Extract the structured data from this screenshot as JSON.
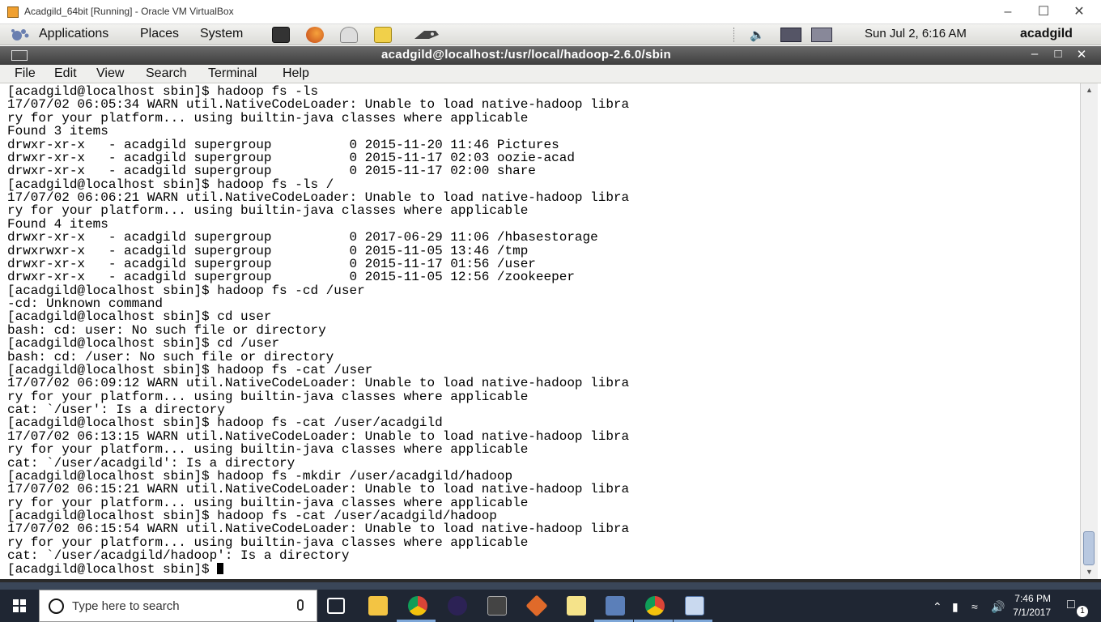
{
  "host_window": {
    "title": "Acadgild_64bit [Running] - Oracle VM VirtualBox"
  },
  "gnome_panel": {
    "menus": [
      "Applications",
      "Places",
      "System"
    ],
    "clock": "Sun Jul  2,  6:16 AM",
    "user": "acadgild"
  },
  "terminal": {
    "title": "acadgild@localhost:/usr/local/hadoop-2.6.0/sbin",
    "menus": [
      "File",
      "Edit",
      "View",
      "Search",
      "Terminal",
      "Help"
    ],
    "lines": [
      "[acadgild@localhost sbin]$ hadoop fs -ls",
      "17/07/02 06:05:34 WARN util.NativeCodeLoader: Unable to load native-hadoop libra",
      "ry for your platform... using builtin-java classes where applicable",
      "Found 3 items",
      "drwxr-xr-x   - acadgild supergroup          0 2015-11-20 11:46 Pictures",
      "drwxr-xr-x   - acadgild supergroup          0 2015-11-17 02:03 oozie-acad",
      "drwxr-xr-x   - acadgild supergroup          0 2015-11-17 02:00 share",
      "[acadgild@localhost sbin]$ hadoop fs -ls /",
      "17/07/02 06:06:21 WARN util.NativeCodeLoader: Unable to load native-hadoop libra",
      "ry for your platform... using builtin-java classes where applicable",
      "Found 4 items",
      "drwxr-xr-x   - acadgild supergroup          0 2017-06-29 11:06 /hbasestorage",
      "drwxrwxr-x   - acadgild supergroup          0 2015-11-05 13:46 /tmp",
      "drwxr-xr-x   - acadgild supergroup          0 2015-11-17 01:56 /user",
      "drwxr-xr-x   - acadgild supergroup          0 2015-11-05 12:56 /zookeeper",
      "[acadgild@localhost sbin]$ hadoop fs -cd /user",
      "-cd: Unknown command",
      "[acadgild@localhost sbin]$ cd user",
      "bash: cd: user: No such file or directory",
      "[acadgild@localhost sbin]$ cd /user",
      "bash: cd: /user: No such file or directory",
      "[acadgild@localhost sbin]$ hadoop fs -cat /user",
      "17/07/02 06:09:12 WARN util.NativeCodeLoader: Unable to load native-hadoop libra",
      "ry for your platform... using builtin-java classes where applicable",
      "cat: `/user': Is a directory",
      "[acadgild@localhost sbin]$ hadoop fs -cat /user/acadgild",
      "17/07/02 06:13:15 WARN util.NativeCodeLoader: Unable to load native-hadoop libra",
      "ry for your platform... using builtin-java classes where applicable",
      "cat: `/user/acadgild': Is a directory",
      "[acadgild@localhost sbin]$ hadoop fs -mkdir /user/acadgild/hadoop",
      "17/07/02 06:15:21 WARN util.NativeCodeLoader: Unable to load native-hadoop libra",
      "ry for your platform... using builtin-java classes where applicable",
      "[acadgild@localhost sbin]$ hadoop fs -cat /user/acadgild/hadoop",
      "17/07/02 06:15:54 WARN util.NativeCodeLoader: Unable to load native-hadoop libra",
      "ry for your platform... using builtin-java classes where applicable",
      "cat: `/user/acadgild/hadoop': Is a directory"
    ],
    "prompt": "[acadgild@localhost sbin]$ "
  },
  "taskbar": {
    "search_placeholder": "Type here to search",
    "time": "7:46 PM",
    "date": "7/1/2017",
    "notification_count": "1"
  },
  "colors": {
    "terminal_titlebar": "#3d3d3d",
    "taskbar": "#1f2633",
    "accent": "#7ea7d8"
  }
}
